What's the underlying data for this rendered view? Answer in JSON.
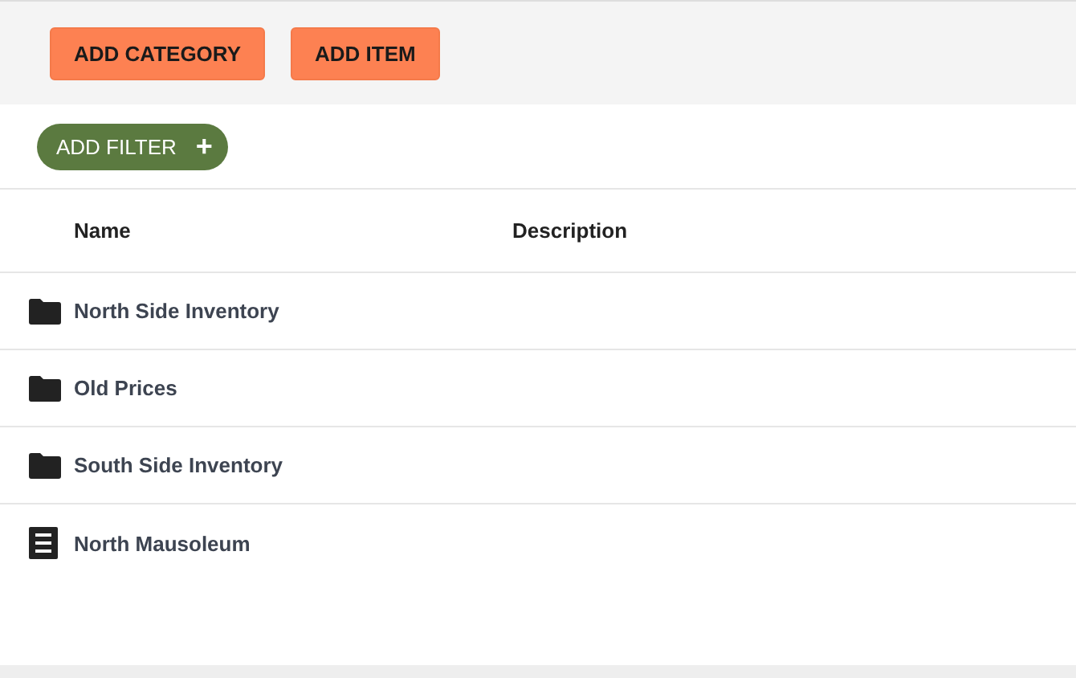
{
  "toolbar": {
    "buttons": [
      "ADD CATEGORY",
      "ADD ITEM"
    ]
  },
  "filter_button": {
    "label": "ADD FILTER",
    "icon": "+"
  },
  "table": {
    "columns": [
      "Name",
      "Description"
    ],
    "rows": [
      {
        "kind": "folder",
        "name": "North Side Inventory"
      },
      {
        "kind": "folder",
        "name": "Old Prices"
      },
      {
        "kind": "folder",
        "name": "South Side Inventory"
      },
      {
        "kind": "item",
        "name": "North Mausoleum"
      }
    ]
  }
}
